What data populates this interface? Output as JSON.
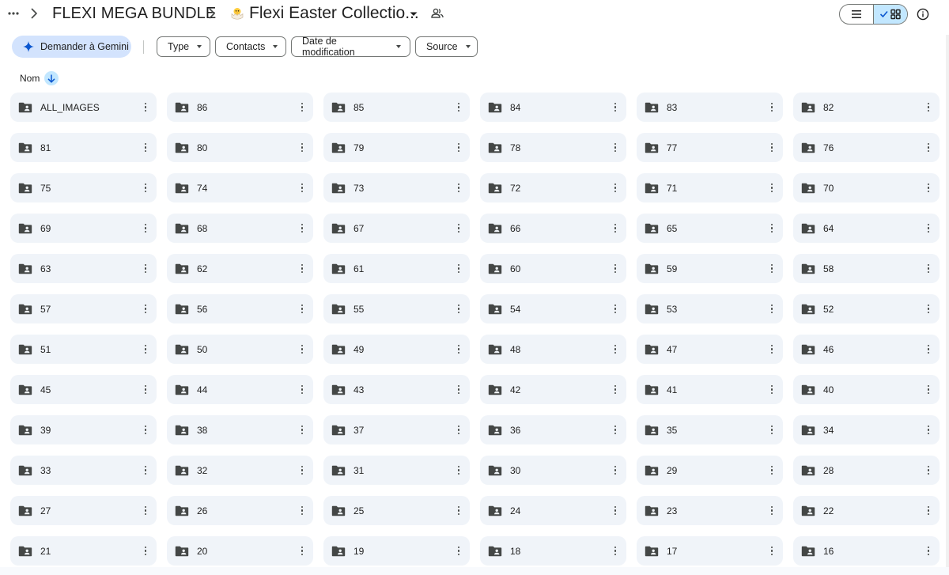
{
  "breadcrumb": {
    "root": "FLEXI MEGA BUNDLE",
    "current": "Flexi Easter Collectio..."
  },
  "filters": {
    "gemini": "Demander à Gemini",
    "chips": [
      "Type",
      "Contacts",
      "Date de modification",
      "Source"
    ]
  },
  "sort": {
    "label": "Nom"
  },
  "folders": [
    "ALL_IMAGES",
    "86",
    "85",
    "84",
    "83",
    "82",
    "81",
    "80",
    "79",
    "78",
    "77",
    "76",
    "75",
    "74",
    "73",
    "72",
    "71",
    "70",
    "69",
    "68",
    "67",
    "66",
    "65",
    "64",
    "63",
    "62",
    "61",
    "60",
    "59",
    "58",
    "57",
    "56",
    "55",
    "54",
    "53",
    "52",
    "51",
    "50",
    "49",
    "48",
    "47",
    "46",
    "45",
    "44",
    "43",
    "42",
    "41",
    "40",
    "39",
    "38",
    "37",
    "36",
    "35",
    "34",
    "33",
    "32",
    "31",
    "30",
    "29",
    "28",
    "27",
    "26",
    "25",
    "24",
    "23",
    "22",
    "21",
    "20",
    "19",
    "18",
    "17",
    "16"
  ],
  "colors": {
    "accent": "#0b57d0",
    "chip_active": "#c2e7ff",
    "card_bg": "#f0f4f9"
  }
}
